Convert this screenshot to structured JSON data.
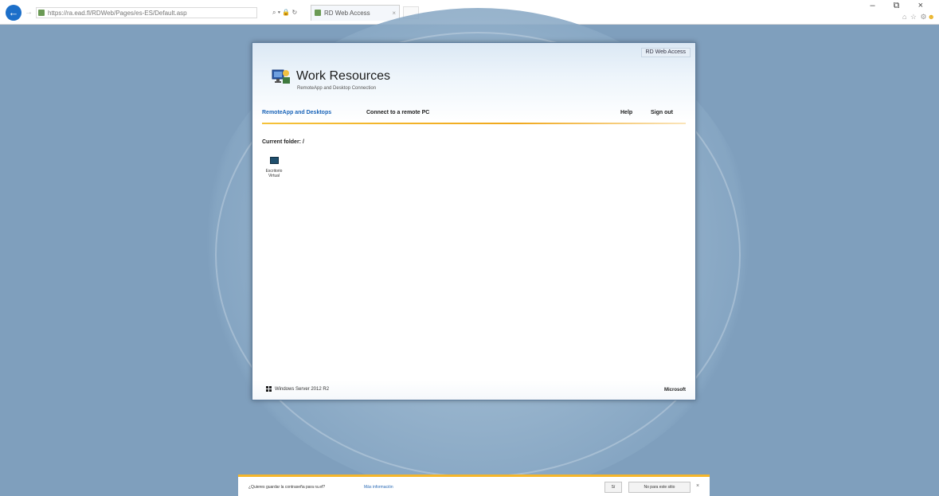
{
  "browser": {
    "address": "https://ra.ead.fl/RDWeb/Pages/es-ES/Default.aspx",
    "address_tools": "⌕ ▾ 🔒 ↻",
    "tab_title": "RD Web Access",
    "tab_close": "×",
    "window_controls": "– ⧉ ×",
    "toolbar_icons": "⌂ ☆ ⚙"
  },
  "rdweb": {
    "brand_badge": "RD Web Access",
    "title": "Work Resources",
    "subtitle": "RemoteApp and Desktop Connection",
    "nav": {
      "remoteapp": "RemoteApp and Desktops",
      "connect": "Connect to a remote PC",
      "help": "Help",
      "sign_out": "Sign out"
    },
    "current_folder": "Current folder: /",
    "resources": [
      {
        "label": "Escritorio Virtual",
        "icon": "desktop-icon"
      }
    ],
    "footer_left": "Windows Server 2012 R2",
    "footer_right": "Microsoft"
  },
  "notification": {
    "text": "¿Quieres guardar la contraseña para ra.ef?",
    "link": "Más información",
    "yes": "Sí",
    "never": "No para este sitio",
    "close": "×"
  },
  "colors": {
    "desktop_background": "#7f9fbd",
    "accent_blue": "#1a64b8",
    "nav_underline": "#f5c23a",
    "notification_bar": "#f5b62a"
  }
}
